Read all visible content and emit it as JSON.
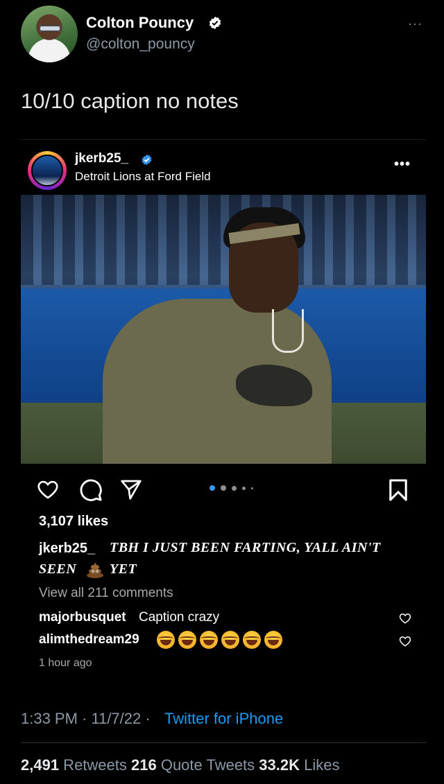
{
  "tweet": {
    "author_name": "Colton Pouncy",
    "author_handle": "@colton_pouncy",
    "more": "···",
    "text": "10/10 caption no notes",
    "timestamp": "1:33 PM · 11/7/22 · ",
    "client": "Twitter for iPhone",
    "stats": {
      "retweets_count": "2,491",
      "retweets_label": " Retweets ",
      "quotes_count": "216",
      "quotes_label": " Quote Tweets ",
      "likes_count": "33.2K",
      "likes_label": " Likes"
    },
    "colors": {
      "accent": "#1d9bf0",
      "secondary_text": "#8b98a5"
    }
  },
  "instagram_post": {
    "username": "jkerb25_",
    "location": "Detroit Lions at Ford Field",
    "more": "•••",
    "likes": "3,107 likes",
    "caption_user": "jkerb25_",
    "caption_line1": "TBH I JUST BEEN FARTING, YALL AIN'T",
    "caption_line2_a": "SEEN",
    "caption_emoji": "poop-emoji",
    "caption_line2_b": "YET",
    "view_comments": "View all 211 comments",
    "comments": [
      {
        "user": "majorbusquet",
        "text": "Caption crazy"
      },
      {
        "user": "alimthedream29",
        "emojis": [
          "laughing-emoji",
          "laughing-emoji",
          "laughing-emoji",
          "laughing-emoji",
          "laughing-emoji",
          "laughing-emoji"
        ]
      }
    ],
    "time_ago": "1 hour ago",
    "carousel": {
      "total": 5,
      "active": 1
    },
    "colors": {
      "accent": "#3897f0"
    }
  }
}
